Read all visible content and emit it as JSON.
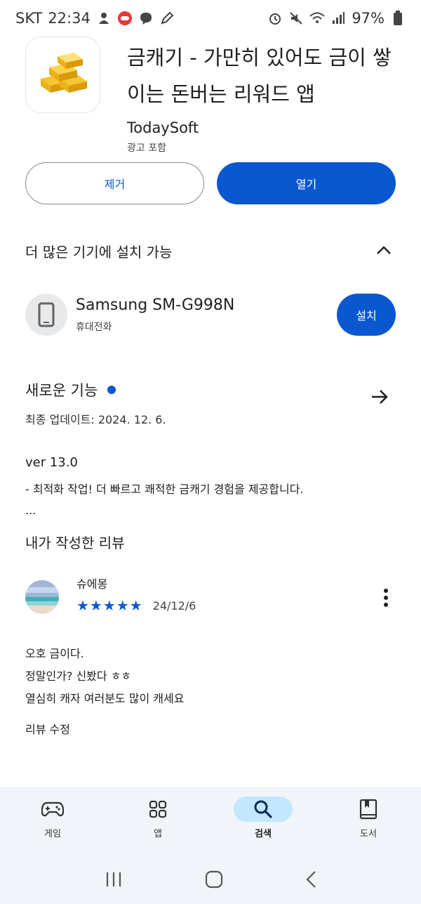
{
  "status_bar": {
    "carrier": "SKT",
    "time": "22:34",
    "battery": "97%"
  },
  "app": {
    "title": "금캐기 - 가만히 있어도 금이 쌓이는 돈버는 리워드 앱",
    "developer": "TodaySoft",
    "ads_label": "광고 포함",
    "uninstall_label": "제거",
    "open_label": "열기"
  },
  "devices": {
    "title": "더 많은 기기에 설치 가능",
    "device_name": "Samsung SM-G998N",
    "device_type": "휴대전화",
    "install_label": "설치"
  },
  "whats_new": {
    "title": "새로운 기능",
    "updated": "최종 업데이트: 2024. 12. 6.",
    "version": "ver 13.0",
    "note": "- 최적화 작업! 더 빠르고 쾌적한 금캐기 경험을 제공합니다.",
    "more": "..."
  },
  "my_review": {
    "title": "내가 작성한 리뷰",
    "reviewer": "슈에몽",
    "rating": 5,
    "stars": "★★★★★",
    "date": "24/12/6",
    "lines": [
      "오호 금이다.",
      "정말인가? 신봤다 ㅎㅎ",
      "열심히 캐자 여러분도 많이 캐세요"
    ],
    "edit_label": "리뷰 수정"
  },
  "bottom_nav": {
    "items": [
      {
        "label": "게임",
        "icon": "gamepad-icon"
      },
      {
        "label": "앱",
        "icon": "apps-grid-icon"
      },
      {
        "label": "검색",
        "icon": "search-icon"
      },
      {
        "label": "도서",
        "icon": "book-icon"
      }
    ],
    "active": "검색"
  },
  "colors": {
    "accent": "#0b57d0",
    "nav_bg": "#f1f4f9",
    "active_pill": "#c2e7ff"
  }
}
